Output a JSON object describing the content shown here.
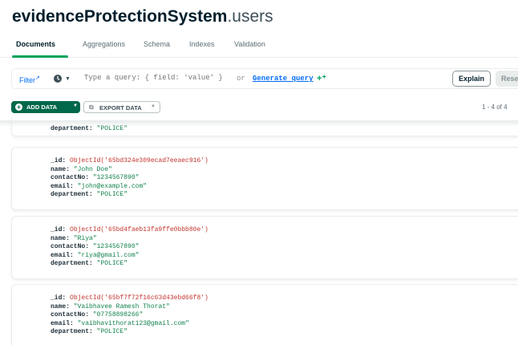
{
  "header": {
    "db": "evidenceProtectionSystem",
    "collection": ".users"
  },
  "tabs": [
    {
      "label": "Documents",
      "active": true
    },
    {
      "label": "Aggregations",
      "active": false
    },
    {
      "label": "Schema",
      "active": false
    },
    {
      "label": "Indexes",
      "active": false
    },
    {
      "label": "Validation",
      "active": false
    }
  ],
  "query": {
    "filter_label": "Filter",
    "placeholder": "Type a query: { field: 'value' }",
    "or_text": "or",
    "generate_link": "Generate query",
    "explain_label": "Explain",
    "reset_label": "Reset"
  },
  "toolbar": {
    "add_data_label": "ADD DATA",
    "export_data_label": "EXPORT DATA",
    "pagination": "1 - 4 of 4"
  },
  "field_labels": {
    "id": "_id:",
    "name": "name:",
    "contact": "contactNo:",
    "email": "email:",
    "department": "department:"
  },
  "documents": [
    {
      "department": "\"POLICE\""
    },
    {
      "id": "ObjectId('65bd324e309ecad7eeaec916')",
      "name": "\"John Doe\"",
      "contactNo": "\"1234567890\"",
      "email": "\"john@example.com\"",
      "department": "\"POLICE\""
    },
    {
      "id": "ObjectId('65bd4faeb13fa9ffe0bbb80e')",
      "name": "\"Riya\"",
      "contactNo": "\"1234567890\"",
      "email": "\"riya@gmail.com\"",
      "department": "\"POLICE\""
    },
    {
      "id": "ObjectId('65bf7f72f16c63d43ebd66f8')",
      "name": "\"Vaibhavee Ramesh Thorat\"",
      "contactNo": "\"07758898266\"",
      "email": "\"vaibhavithorat123@gmail.com\"",
      "department": "\"POLICE\""
    }
  ],
  "icons": [
    "external-link-icon",
    "clock-icon",
    "chevron-down-icon",
    "sparkle-icon",
    "plus-circle-icon",
    "export-icon"
  ],
  "colors": {
    "accent_green": "#00684a",
    "tab_underline": "#00a35c",
    "link_blue": "#016bf8",
    "string_value": "#12824d",
    "objectid_value": "#c3342d"
  }
}
